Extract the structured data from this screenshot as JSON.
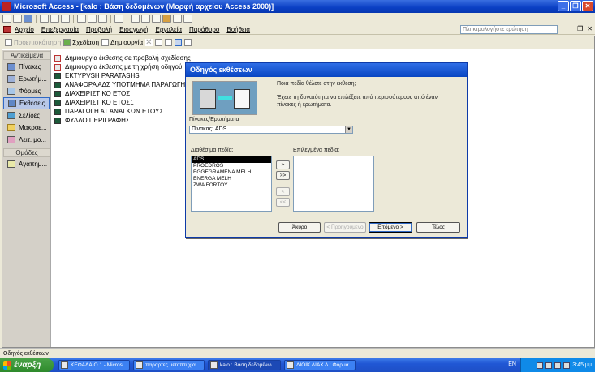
{
  "window": {
    "title": "Microsoft Access - [kalo : Βάση δεδομένων (Μορφή αρχείου Access 2000)]"
  },
  "menubar": {
    "items": [
      "Αρχείο",
      "Επεξεργασία",
      "Προβολή",
      "Εισαγωγή",
      "Εργαλεία",
      "Παράθυρο",
      "Βοήθεια"
    ],
    "help_placeholder": "Πληκτρολογήστε ερώτηση"
  },
  "db_toolbar": {
    "preview": "Προεπισκόπηση",
    "design": "Σχεδίαση",
    "create": "Δημιουργία"
  },
  "objects_bar": {
    "header": "Αντικείμενα",
    "items": [
      "Πίνακες",
      "Ερωτήμ...",
      "Φόρμες",
      "Εκθέσεις",
      "Σελίδες",
      "Μακροε...",
      "Λειτ. μο..."
    ],
    "groups_header": "Ομάδες",
    "group_items": [
      "Αγαπημ..."
    ]
  },
  "object_list": [
    "Δημιουργία έκθεσης σε προβολή σχεδίασης",
    "Δημιουργία έκθεσης με τη χρήση οδηγού",
    "EKTYPVSH PARATASHS",
    "ΑΝΑΦΟΡΑ ΑΔΣ ΥΠΟΤΜΗΜΑ ΠΑΡΑΓΩΓΗ ΕΤΟΣ",
    "ΔΙΑΧΕΙΡΙΣΤΙΚΟ ΕΤΟΣ",
    "ΔΙΑΧΕΙΡΙΣΤΙΚΟ ΕΤΟΣ1",
    "ΠΑΡΑΓΩΓΗ ΑΤ ΑΝΑΓΚΩΝ ΕΤΟΥΣ",
    "ΦΥΛΛΟ ΠΕΡΙΓΡΑΦΗΣ"
  ],
  "wizard": {
    "title": "Οδηγός εκθέσεων",
    "question": "Ποια πεδία θέλετε στην έκθεση;",
    "hint": "Έχετε τη δυνατότητα να επιλέξετε από περισσότερους από έναν πίνακες ή ερωτήματα.",
    "source_label": "Πίνακες/Ερωτήματα",
    "source_value": "Πίνακας: ADS",
    "available_label": "Διαθέσιμα πεδία:",
    "selected_label": "Επιλεγμένα πεδία:",
    "available_fields": [
      "ADS",
      "PROEDROS",
      "EGGEGRAMENA MELH",
      "ENERGA MELH",
      "ZWA FORTOY"
    ],
    "move_buttons": [
      ">",
      ">>",
      "<",
      "<<"
    ],
    "buttons": {
      "cancel": "Άκυρο",
      "back": "< Προηγούμενο",
      "next": "Επόμενο >",
      "finish": "Τέλος"
    }
  },
  "statusbar": {
    "text": "Οδηγός εκθέσεων"
  },
  "taskbar": {
    "start": "έναρξη",
    "tasks": [
      "ΚΕΦΑΛΑΙΟ 1 - Micros...",
      "παραρτες μεταπτυχια...",
      "kalo : Βάση δεδομένω...",
      "ΔΙΟΙΚ ΔΙΑΧ Δ : Φόρμα"
    ],
    "lang": "EN",
    "clock": "3:45 μμ"
  }
}
